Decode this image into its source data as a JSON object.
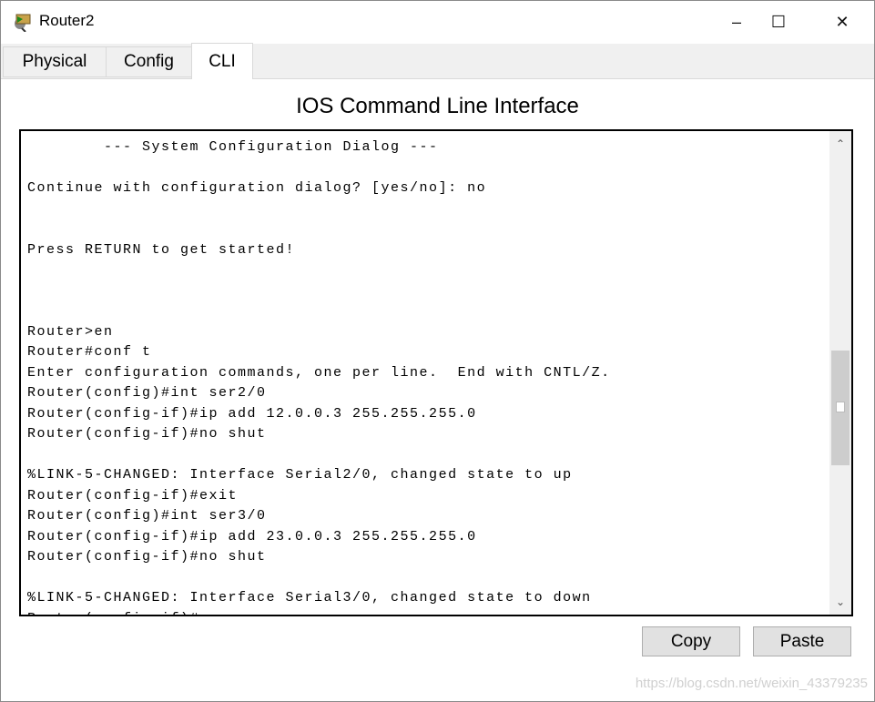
{
  "window": {
    "title": "Router2",
    "app_icon": "router-icon",
    "controls": {
      "minimize": "–",
      "maximize": "☐",
      "close": "✕"
    }
  },
  "tabs": [
    {
      "label": "Physical"
    },
    {
      "label": "Config"
    },
    {
      "label": "CLI",
      "active": true
    }
  ],
  "heading": "IOS Command Line Interface",
  "terminal": {
    "lines": [
      "        --- System Configuration Dialog ---",
      "",
      "Continue with configuration dialog? [yes/no]: no",
      "",
      "",
      "Press RETURN to get started!",
      "",
      "",
      "",
      "Router>en",
      "Router#conf t",
      "Enter configuration commands, one per line.  End with CNTL/Z.",
      "Router(config)#int ser2/0",
      "Router(config-if)#ip add 12.0.0.3 255.255.255.0",
      "Router(config-if)#no shut",
      "",
      "%LINK-5-CHANGED: Interface Serial2/0, changed state to up",
      "Router(config-if)#exit",
      "Router(config)#int ser3/0",
      "Router(config-if)#ip add 23.0.0.3 255.255.255.0",
      "Router(config-if)#no shut",
      "",
      "%LINK-5-CHANGED: Interface Serial3/0, changed state to down",
      "Router(config-if)#"
    ],
    "scroll_up": "^",
    "scroll_down": "v"
  },
  "buttons": {
    "copy": "Copy",
    "paste": "Paste"
  },
  "watermark": "https://blog.csdn.net/weixin_43379235"
}
